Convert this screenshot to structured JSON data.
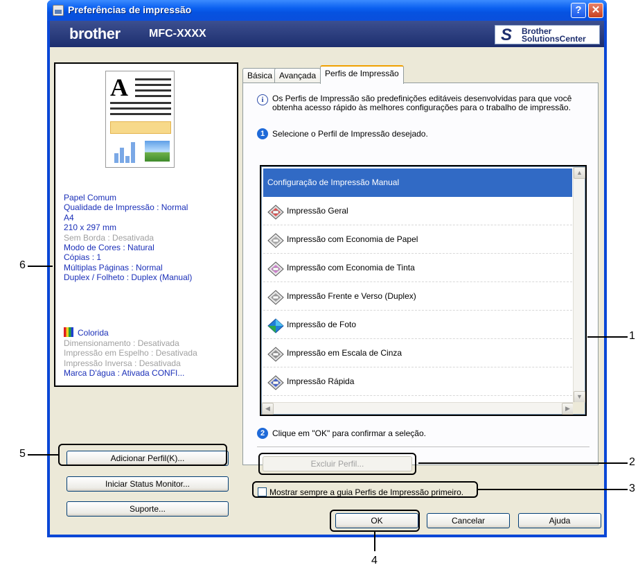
{
  "window": {
    "title": "Preferências de impressão",
    "help_label": "?",
    "close_label": "✕"
  },
  "banner": {
    "brand": "brother",
    "model": "MFC-XXXX",
    "solutions_mark": "S",
    "solutions_line1": "Brother",
    "solutions_line2": "SolutionsCenter"
  },
  "preview": {
    "doc_letter": "A",
    "info_lines": [
      {
        "text": "Papel Comum",
        "style": "blue"
      },
      {
        "text": "Qualidade de Impressão : Normal",
        "style": "blue"
      },
      {
        "text": "A4",
        "style": "blue"
      },
      {
        "text": "210 x 297 mm",
        "style": "blue"
      },
      {
        "text": "Sem Borda : Desativada",
        "style": "gray"
      },
      {
        "text": "Modo de Cores : Natural",
        "style": "blue"
      },
      {
        "text": "Cópias : 1",
        "style": "blue"
      },
      {
        "text": "Múltiplas Páginas : Normal",
        "style": "blue"
      },
      {
        "text": "Duplex / Folheto : Duplex (Manual)",
        "style": "blue"
      }
    ],
    "color_label": "Colorida",
    "info_lines2": [
      {
        "text": "Dimensionamento : Desativada",
        "style": "gray"
      },
      {
        "text": "Impressão em Espelho : Desativada",
        "style": "gray"
      },
      {
        "text": "Impressão Inversa : Desativada",
        "style": "gray"
      },
      {
        "text": "Marca D'água : Ativada  CONFI...",
        "style": "blue"
      }
    ]
  },
  "left_buttons": {
    "add_profile": "Adicionar Perfil(K)...",
    "status_monitor": "Iniciar Status Monitor...",
    "support": "Suporte..."
  },
  "tabs": [
    {
      "label": "Básica"
    },
    {
      "label": "Avançada"
    },
    {
      "label": "Perfis de Impressão",
      "active": true
    }
  ],
  "profiles_tab": {
    "intro": "Os Perfis de Impressão são predefinições editáveis desenvolvidas para que você obtenha acesso rápido às melhores configurações para o trabalho de impressão.",
    "step1_num": "1",
    "step1": "Selecione o Perfil de Impressão desejado.",
    "items": [
      {
        "label": "Configuração de Impressão Manual",
        "selected": true,
        "icon": "none"
      },
      {
        "label": "Impressão Geral",
        "icon": "general-print-icon"
      },
      {
        "label": "Impressão com Economia de Papel",
        "icon": "paper-saving-icon"
      },
      {
        "label": "Impressão com Economia de Tinta",
        "icon": "ink-saving-icon"
      },
      {
        "label": "Impressão Frente e Verso (Duplex)",
        "icon": "duplex-icon"
      },
      {
        "label": "Impressão de Foto",
        "icon": "photo-print-icon"
      },
      {
        "label": "Impressão em Escala de Cinza",
        "icon": "grayscale-icon"
      },
      {
        "label": "Impressão Rápida",
        "icon": "fast-print-icon"
      }
    ],
    "step2_num": "2",
    "step2": "Clique em \"OK\" para confirmar a seleção.",
    "delete_button": "Excluir Perfil...",
    "always_show": "Mostrar sempre a guia Perfis de Impressão primeiro.",
    "always_show_checked": false
  },
  "footer_buttons": {
    "ok": "OK",
    "cancel": "Cancelar",
    "help": "Ajuda"
  },
  "annotations": {
    "n1": "1",
    "n2": "2",
    "n3": "3",
    "n4": "4",
    "n5": "5",
    "n6": "6"
  }
}
